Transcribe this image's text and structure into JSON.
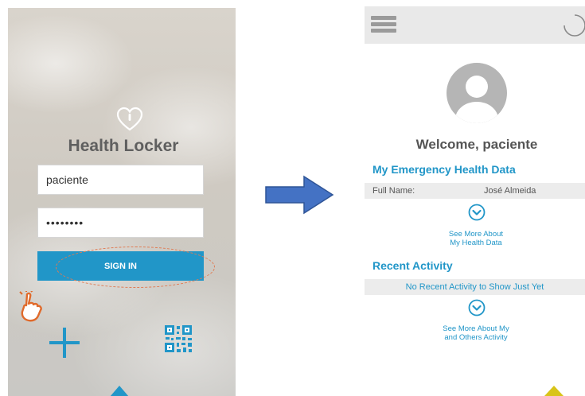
{
  "login": {
    "title": "Health Locker",
    "username_value": "paciente",
    "password_value": "••••••••",
    "signin_label": "SIGN IN"
  },
  "dashboard": {
    "welcome": "Welcome, paciente",
    "emergency": {
      "heading": "My Emergency Health Data",
      "full_name_label": "Full Name:",
      "full_name_value": "José Almeida",
      "more_line1": "See More About",
      "more_line2": "My Health Data"
    },
    "activity": {
      "heading": "Recent Activity",
      "empty_text": "No Recent Activity to Show Just Yet",
      "more_line1": "See More About My",
      "more_line2": "and Others Activity"
    }
  },
  "colors": {
    "accent": "#2196c8",
    "tap_hand": "#e06a2b",
    "corner_marker": "#d8c418"
  }
}
